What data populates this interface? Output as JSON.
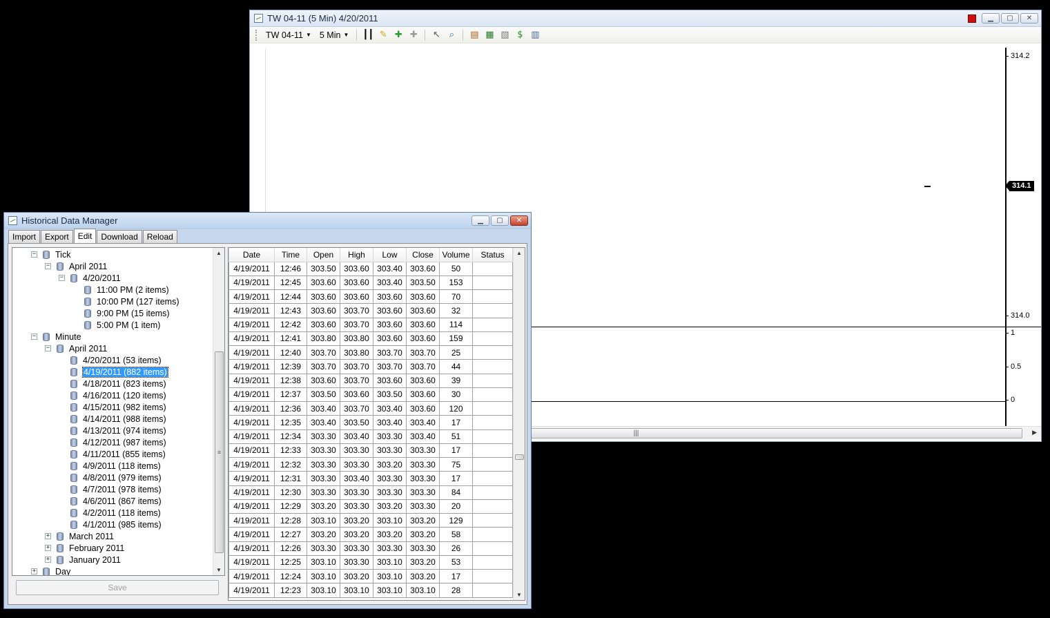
{
  "chart_window": {
    "title": "TW 04-11 (5 Min)  4/20/2011",
    "toolbar": {
      "instrument": "TW 04-11",
      "interval": "5 Min",
      "icons": [
        "bar-type-icon",
        "pencil-draw-icon",
        "add-indicator-icon",
        "remove-indicator-icon",
        "cursor-select-icon",
        "zoom-icon",
        "data-box-icon",
        "strategy-icon",
        "chart-properties-icon",
        "dollar-icon",
        "layout-icon"
      ]
    },
    "price_axis": {
      "top_label": "314.2",
      "current_price": "314.1",
      "bottom_label": "314.0"
    },
    "volume_axis": {
      "labels": [
        "1",
        "0.5",
        "0"
      ]
    },
    "scrollbar_grip": "|||",
    "colors": {
      "current_price_flag": "#000000",
      "title_red_square": "#d01010"
    }
  },
  "hdm_window": {
    "title": "Historical Data Manager",
    "tabs": [
      "Import",
      "Export",
      "Edit",
      "Download",
      "Reload"
    ],
    "active_tab": "Edit",
    "tree": [
      {
        "level": 2,
        "toggle": "−",
        "label": "Tick"
      },
      {
        "level": 3,
        "toggle": "−",
        "label": "April 2011"
      },
      {
        "level": 4,
        "toggle": "−",
        "label": "4/20/2011"
      },
      {
        "level": 5,
        "toggle": "",
        "label": "11:00 PM (2 items)"
      },
      {
        "level": 5,
        "toggle": "",
        "label": "10:00 PM (127 items)"
      },
      {
        "level": 5,
        "toggle": "",
        "label": "9:00 PM (15 items)"
      },
      {
        "level": 5,
        "toggle": "",
        "label": "5:00 PM (1 item)"
      },
      {
        "level": 2,
        "toggle": "−",
        "label": "Minute"
      },
      {
        "level": 3,
        "toggle": "−",
        "label": "April 2011"
      },
      {
        "level": 4,
        "toggle": "",
        "label": "4/20/2011 (53 items)"
      },
      {
        "level": 4,
        "toggle": "",
        "label": "4/19/2011 (882 items)",
        "selected": true
      },
      {
        "level": 4,
        "toggle": "",
        "label": "4/18/2011 (823 items)"
      },
      {
        "level": 4,
        "toggle": "",
        "label": "4/16/2011 (120 items)"
      },
      {
        "level": 4,
        "toggle": "",
        "label": "4/15/2011 (982 items)"
      },
      {
        "level": 4,
        "toggle": "",
        "label": "4/14/2011 (988 items)"
      },
      {
        "level": 4,
        "toggle": "",
        "label": "4/13/2011 (974 items)"
      },
      {
        "level": 4,
        "toggle": "",
        "label": "4/12/2011 (987 items)"
      },
      {
        "level": 4,
        "toggle": "",
        "label": "4/11/2011 (855 items)"
      },
      {
        "level": 4,
        "toggle": "",
        "label": "4/9/2011 (118 items)"
      },
      {
        "level": 4,
        "toggle": "",
        "label": "4/8/2011 (979 items)"
      },
      {
        "level": 4,
        "toggle": "",
        "label": "4/7/2011 (978 items)"
      },
      {
        "level": 4,
        "toggle": "",
        "label": "4/6/2011 (867 items)"
      },
      {
        "level": 4,
        "toggle": "",
        "label": "4/2/2011 (118 items)"
      },
      {
        "level": 4,
        "toggle": "",
        "label": "4/1/2011 (985 items)"
      },
      {
        "level": 3,
        "toggle": "+",
        "label": "March 2011"
      },
      {
        "level": 3,
        "toggle": "+",
        "label": "February 2011"
      },
      {
        "level": 3,
        "toggle": "+",
        "label": "January 2011"
      },
      {
        "level": 2,
        "toggle": "+",
        "label": "Day"
      }
    ],
    "save_label": "Save",
    "grid": {
      "columns": [
        "Date",
        "Time",
        "Open",
        "High",
        "Low",
        "Close",
        "Volume",
        "Status"
      ],
      "rows": [
        [
          "4/19/2011",
          "12:46",
          "303.50",
          "303.60",
          "303.40",
          "303.60",
          "50",
          ""
        ],
        [
          "4/19/2011",
          "12:45",
          "303.60",
          "303.60",
          "303.40",
          "303.50",
          "153",
          ""
        ],
        [
          "4/19/2011",
          "12:44",
          "303.60",
          "303.60",
          "303.60",
          "303.60",
          "70",
          ""
        ],
        [
          "4/19/2011",
          "12:43",
          "303.60",
          "303.70",
          "303.60",
          "303.60",
          "32",
          ""
        ],
        [
          "4/19/2011",
          "12:42",
          "303.60",
          "303.70",
          "303.60",
          "303.60",
          "114",
          ""
        ],
        [
          "4/19/2011",
          "12:41",
          "303.80",
          "303.80",
          "303.60",
          "303.60",
          "159",
          ""
        ],
        [
          "4/19/2011",
          "12:40",
          "303.70",
          "303.80",
          "303.70",
          "303.70",
          "25",
          ""
        ],
        [
          "4/19/2011",
          "12:39",
          "303.70",
          "303.70",
          "303.70",
          "303.70",
          "44",
          ""
        ],
        [
          "4/19/2011",
          "12:38",
          "303.60",
          "303.70",
          "303.60",
          "303.60",
          "39",
          ""
        ],
        [
          "4/19/2011",
          "12:37",
          "303.50",
          "303.60",
          "303.50",
          "303.60",
          "30",
          ""
        ],
        [
          "4/19/2011",
          "12:36",
          "303.40",
          "303.70",
          "303.40",
          "303.60",
          "120",
          ""
        ],
        [
          "4/19/2011",
          "12:35",
          "303.40",
          "303.50",
          "303.40",
          "303.40",
          "17",
          ""
        ],
        [
          "4/19/2011",
          "12:34",
          "303.30",
          "303.40",
          "303.30",
          "303.40",
          "51",
          ""
        ],
        [
          "4/19/2011",
          "12:33",
          "303.30",
          "303.30",
          "303.30",
          "303.30",
          "17",
          ""
        ],
        [
          "4/19/2011",
          "12:32",
          "303.30",
          "303.30",
          "303.20",
          "303.30",
          "75",
          ""
        ],
        [
          "4/19/2011",
          "12:31",
          "303.30",
          "303.40",
          "303.30",
          "303.30",
          "17",
          ""
        ],
        [
          "4/19/2011",
          "12:30",
          "303.30",
          "303.30",
          "303.30",
          "303.30",
          "84",
          ""
        ],
        [
          "4/19/2011",
          "12:29",
          "303.20",
          "303.30",
          "303.20",
          "303.30",
          "20",
          ""
        ],
        [
          "4/19/2011",
          "12:28",
          "303.10",
          "303.20",
          "303.10",
          "303.20",
          "129",
          ""
        ],
        [
          "4/19/2011",
          "12:27",
          "303.20",
          "303.20",
          "303.20",
          "303.20",
          "58",
          ""
        ],
        [
          "4/19/2011",
          "12:26",
          "303.30",
          "303.30",
          "303.30",
          "303.30",
          "26",
          ""
        ],
        [
          "4/19/2011",
          "12:25",
          "303.10",
          "303.30",
          "303.10",
          "303.20",
          "53",
          ""
        ],
        [
          "4/19/2011",
          "12:24",
          "303.10",
          "303.20",
          "303.10",
          "303.20",
          "17",
          ""
        ],
        [
          "4/19/2011",
          "12:23",
          "303.10",
          "303.10",
          "303.10",
          "303.10",
          "28",
          ""
        ]
      ]
    },
    "colors": {
      "selection": "#3399ff",
      "window_frame": "#c7d8ee"
    }
  }
}
